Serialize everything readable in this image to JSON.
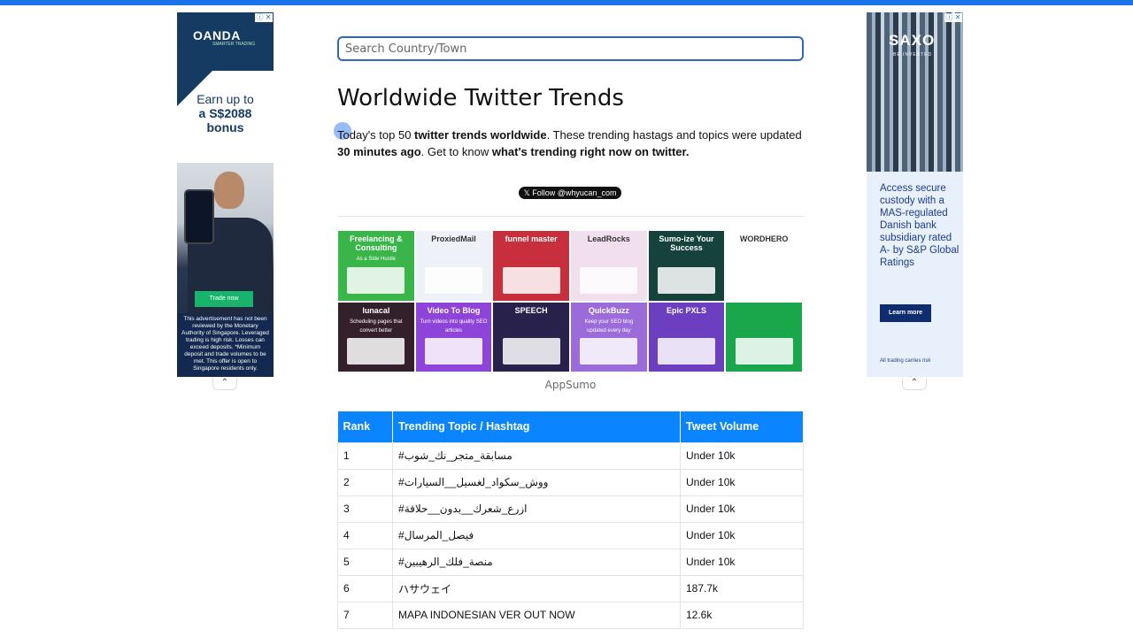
{
  "search": {
    "placeholder": "Search Country/Town"
  },
  "page": {
    "title": "Worldwide Twitter Trends",
    "intro_prefix": "Today's top 50 ",
    "intro_bold1": "twitter trends worldwide",
    "intro_mid": ". These trending hastags and topics were updated ",
    "intro_bold2": "30 minutes ago",
    "intro_mid2": ". Get to know ",
    "intro_bold3": "what's trending right now on twitter.",
    "follow_button": "Follow @whyucan_com"
  },
  "ads": {
    "left": {
      "logo": "OANDA",
      "logo_sub": "SMARTER TRADING",
      "headline1": "Earn up to",
      "headline2": "a S$2088",
      "headline3": "bonus",
      "cta": "Trade now",
      "disclaimer": "This advertisement has not been reviewed by the Monetary Authority of Singapore. Leveraged trading is high risk. Losses can exceed deposits. *Minimum deposit and trade volumes to be met. This offer is open to Singapore residents only."
    },
    "right": {
      "logo": "SAXO",
      "logo_sub": "BE INVESTED",
      "body": "Access secure custody with a MAS-regulated Danish bank subsidiary rated A- by S&P Global Ratings",
      "cta": "Learn more",
      "risk": "All trading carries risk"
    },
    "info_icon": "ⓘ ✕",
    "collapse_icon": "chevron-up-icon"
  },
  "appsumo": {
    "label": "AppSumo",
    "tiles": [
      {
        "title": "Freelancing & Consulting",
        "sub": "As a Side Hustle",
        "color": "#39b54a"
      },
      {
        "title": "ProxiedMail",
        "sub": "",
        "color": "#eef1f8"
      },
      {
        "title": "funnel master",
        "sub": "",
        "color": "#c62f3b"
      },
      {
        "title": "LeadRocks",
        "sub": "",
        "color": "#f1dfee"
      },
      {
        "title": "Sumo-ize Your Success",
        "sub": "",
        "color": "#16423c"
      },
      {
        "title": "WORDHERO",
        "sub": "",
        "color": "#ffffff"
      },
      {
        "title": "lunacal",
        "sub": "Scheduling pages that convert better",
        "color": "#34202a"
      },
      {
        "title": "Video To Blog",
        "sub": "Turn videos into quality SEO articles",
        "color": "#8e44d8"
      },
      {
        "title": "SPEECH",
        "sub": "",
        "color": "#27214c"
      },
      {
        "title": "QuickBuzz",
        "sub": "Keep your SEO blog updated every day",
        "color": "#9b6bd9"
      },
      {
        "title": "Epic PXLS",
        "sub": "",
        "color": "#6b3fc0"
      },
      {
        "title": "",
        "sub": "",
        "color": "#1aa64a"
      }
    ]
  },
  "table": {
    "headers": [
      "Rank",
      "Trending Topic / Hashtag",
      "Tweet Volume"
    ],
    "rows": [
      {
        "rank": "1",
        "topic": "#مسابقة_متجر_نك_شوب",
        "volume": "Under 10k"
      },
      {
        "rank": "2",
        "topic": "#ووش_سكواد_لغسيل__السيارات",
        "volume": "Under 10k"
      },
      {
        "rank": "3",
        "topic": "#ازرع_شعرك__بدون__حلاقة",
        "volume": "Under 10k"
      },
      {
        "rank": "4",
        "topic": "#فيصل_المرسال",
        "volume": "Under 10k"
      },
      {
        "rank": "5",
        "topic": "#منصة_فلك_الرهيبين",
        "volume": "Under 10k"
      },
      {
        "rank": "6",
        "topic": "ハサウェイ",
        "volume": "187.7k"
      },
      {
        "rank": "7",
        "topic": "MAPA INDONESIAN VER OUT NOW",
        "volume": "12.6k"
      }
    ]
  },
  "colors": {
    "accent": "#0a84ff",
    "topbar": "#1a73e8",
    "search_border": "#2f66c4"
  }
}
